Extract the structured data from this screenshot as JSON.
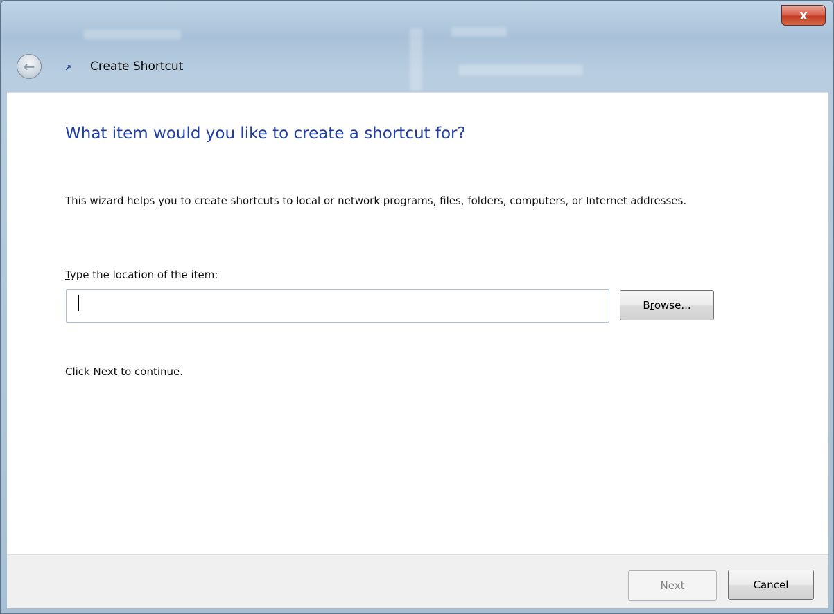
{
  "window": {
    "title": "Create Shortcut",
    "close_label": "x",
    "back_icon": "back-arrow-icon",
    "title_icon": "shortcut-wizard-icon"
  },
  "wizard": {
    "heading": "What item would you like to create a shortcut for?",
    "description": "This wizard helps you to create shortcuts to local or network programs, files, folders, computers, or Internet addresses.",
    "location_label_accel": "T",
    "location_label_rest": "ype the location of the item:",
    "location_value": "",
    "browse_prefix": "B",
    "browse_accel": "r",
    "browse_rest": "owse...",
    "continue_text": "Click Next to continue."
  },
  "footer": {
    "next_accel": "N",
    "next_rest": "ext",
    "cancel_label": "Cancel"
  },
  "colors": {
    "heading": "#1e3fa6",
    "close_button": "#c23c22",
    "glass": "#b8cde0"
  }
}
